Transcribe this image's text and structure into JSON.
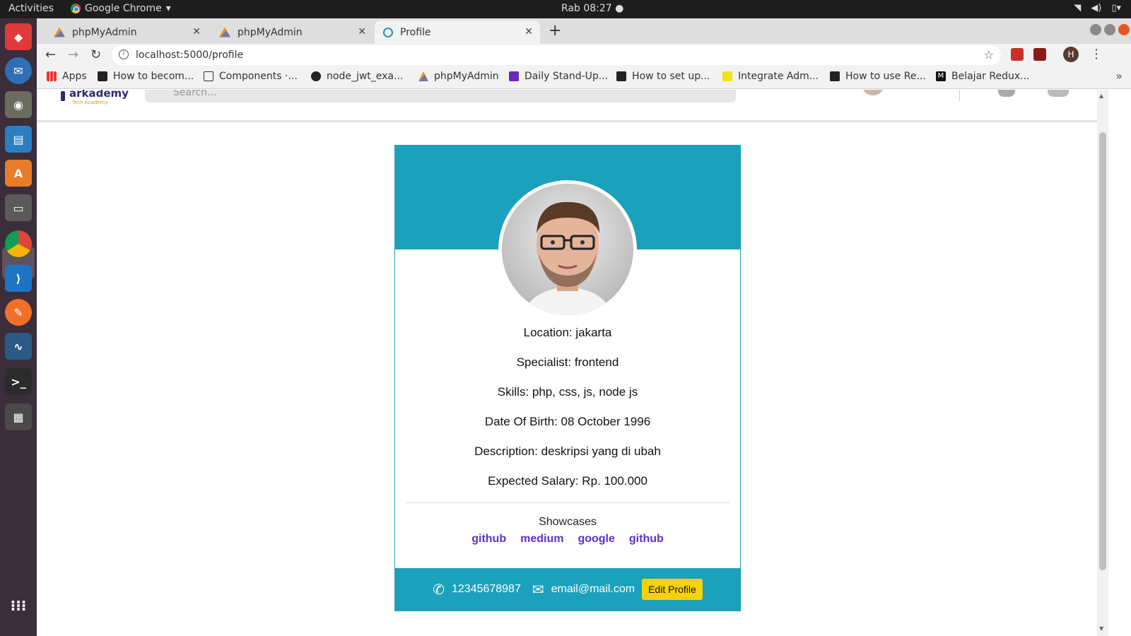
{
  "os": {
    "activities": "Activities",
    "app_name": "Google Chrome",
    "clock": "Rab 08:27"
  },
  "browser": {
    "tabs": [
      {
        "label": "phpMyAdmin",
        "favicon": "phpmyadmin-icon"
      },
      {
        "label": "phpMyAdmin",
        "favicon": "phpmyadmin-icon"
      },
      {
        "label": "Profile",
        "favicon": "react-icon",
        "active": true
      }
    ],
    "url": "localhost:5000/profile",
    "profile_initial": "H",
    "bookmarks": [
      {
        "label": "Apps",
        "icon": "apps-grid-icon"
      },
      {
        "label": "How to becom...",
        "icon": "bookmark-icon"
      },
      {
        "label": "Components ·...",
        "icon": "book-icon"
      },
      {
        "label": "node_jwt_exa...",
        "icon": "github-icon"
      },
      {
        "label": "phpMyAdmin",
        "icon": "phpmyadmin-icon"
      },
      {
        "label": "Daily Stand-Up...",
        "icon": "form-icon"
      },
      {
        "label": "How to set up...",
        "icon": "bookmark-icon"
      },
      {
        "label": "Integrate Adm...",
        "icon": "pen-icon"
      },
      {
        "label": "How to use Re...",
        "icon": "bookmark-icon"
      },
      {
        "label": "Belajar Redux...",
        "icon": "medium-icon"
      }
    ]
  },
  "app": {
    "logo_text": "arkademy",
    "logo_sub": "Tech Academy",
    "search_placeholder": "Search..."
  },
  "profile": {
    "info": [
      "Location: jakarta",
      "Specialist: frontend",
      "Skills: php, css, js, node js",
      "Date Of Birth: 08 October 1996",
      "Description: deskripsi yang di ubah",
      "Expected Salary: Rp. 100.000"
    ],
    "showcases_title": "Showcases",
    "showcases": [
      "github",
      "medium",
      "google",
      "github"
    ],
    "phone": "12345678987",
    "email": "email@mail.com",
    "edit_label": "Edit Profile"
  },
  "colors": {
    "card_accent": "#1ba1bc",
    "link": "#5b2fd6",
    "edit_button": "#f5d10e"
  }
}
